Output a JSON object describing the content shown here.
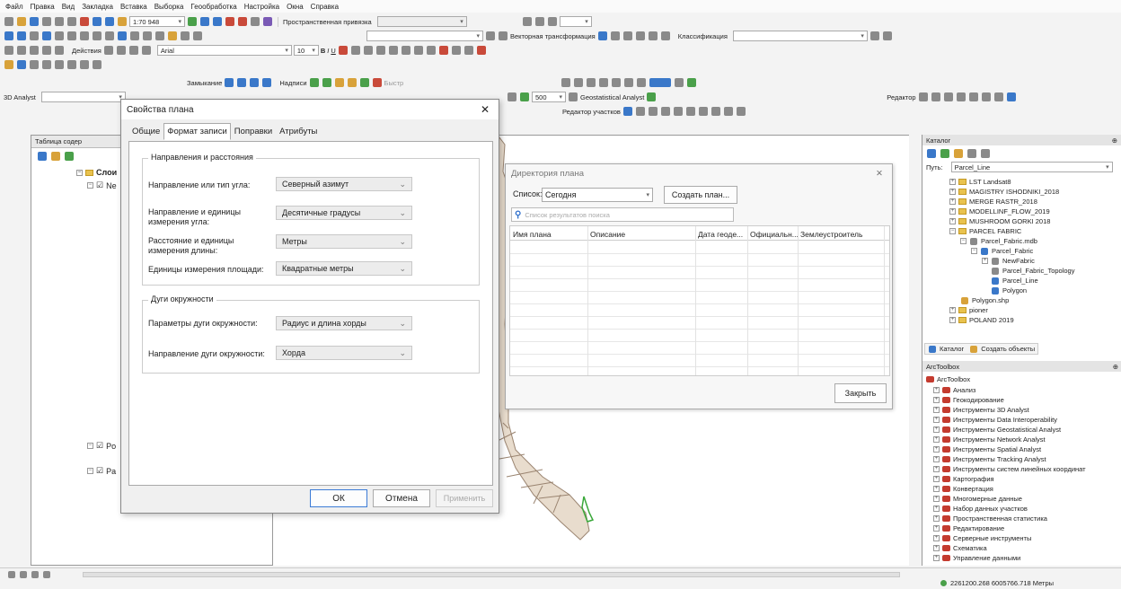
{
  "menu": [
    "Файл",
    "Правка",
    "Вид",
    "Закладка",
    "Вставка",
    "Выборка",
    "Геообработка",
    "Настройка",
    "Окна",
    "Справка"
  ],
  "toolbar": {
    "scale": "1:70 948",
    "spatial_ref": "Пространственная привязка",
    "vector_transform": "Векторная трансформация",
    "classification": "Классификация",
    "actions": "Действия",
    "font": "Arial",
    "font_size": "10",
    "bold": "B",
    "italic": "I",
    "underline": "U",
    "snapping": "Замыкание",
    "labeling": "Надписи",
    "fast": "Быстр",
    "analyst3d": "3D Analyst",
    "geostat": "Geostatistical Analyst",
    "editor": "Редактор",
    "parcel_editor": "Редактор участков",
    "scale2": "500"
  },
  "toc": {
    "title": "Таблица содер",
    "layers_root": "Слои",
    "items": [
      "Ne",
      "Po",
      "Pa"
    ]
  },
  "dialog": {
    "title": "Свойства плана",
    "tabs": [
      "Общие",
      "Формат записи",
      "Поправки",
      "Атрибуты"
    ],
    "group1_title": "Направления и расстояния",
    "rows1": [
      {
        "label": "Направление или тип угла:",
        "value": "Северный азимут"
      },
      {
        "label": "Направление и единицы измерения угла:",
        "value": "Десятичные градусы"
      },
      {
        "label": "Расстояние и единицы измерения длины:",
        "value": "Метры"
      },
      {
        "label": "Единицы измерения площади:",
        "value": "Квадратные метры"
      }
    ],
    "group2_title": "Дуги окружности",
    "rows2": [
      {
        "label": "Параметры дуги окружности:",
        "value": "Радиус и длина хорды"
      },
      {
        "label": "Направление дуги окружности:",
        "value": "Хорда"
      }
    ],
    "ok": "ОК",
    "cancel": "Отмена",
    "apply": "Применить"
  },
  "plan_dialog": {
    "title": "Директория плана",
    "list_label": "Список:",
    "list_value": "Сегодня",
    "create_button": "Создать план...",
    "search_placeholder": "Список результатов поиска",
    "columns": [
      "Имя плана",
      "Описание",
      "Дата геоде...",
      "Официальн...",
      "Землеустроитель"
    ],
    "close": "Закрыть"
  },
  "catalog": {
    "title": "Каталог",
    "path_label": "Путь:",
    "path_value": "Parcel_Line",
    "items": [
      "LST Landsat8",
      "MAGISTRY ISHODNIKI_2018",
      "MERGE RASTR_2018",
      "MODELLINF_FLOW_2019",
      "MUSHROOM GORKI 2018",
      "PARCEL FABRIC",
      "Parcel_Fabric.mdb",
      "Parcel_Fabric",
      "NewFabric",
      "Parcel_Fabric_Topology",
      "Parcel_Line",
      "Polygon",
      "Polygon.shp",
      "pioner",
      "POLAND 2019"
    ],
    "tab_catalog": "Каталог",
    "tab_create": "Создать объекты"
  },
  "toolbox": {
    "title": "ArcToolbox",
    "root": "ArcToolbox",
    "items": [
      "Анализ",
      "Геокодирование",
      "Инструменты 3D Analyst",
      "Инструменты Data Interoperability",
      "Инструменты Geostatistical Analyst",
      "Инструменты Network Analyst",
      "Инструменты Spatial Analyst",
      "Инструменты Tracking Analyst",
      "Инструменты систем линейных координат",
      "Картография",
      "Конвертация",
      "Многомерные данные",
      "Набор данных участков",
      "Пространственная статистика",
      "Редактирование",
      "Серверные инструменты",
      "Схематика",
      "Управление данными"
    ]
  },
  "status": {
    "coords": "2261200.268  6005766.718 Метры"
  }
}
